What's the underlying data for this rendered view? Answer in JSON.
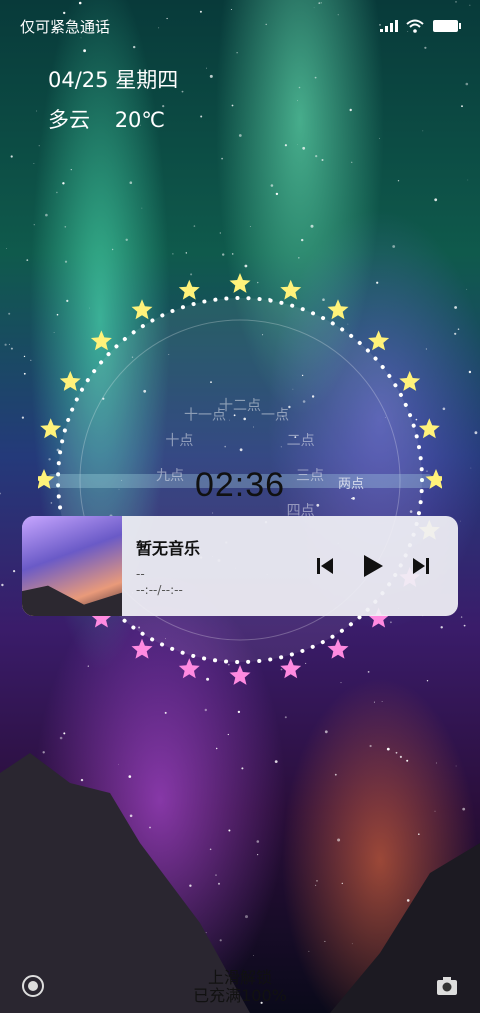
{
  "status_bar": {
    "left_text": "仅可紧急通话",
    "icons": [
      "signal-icon",
      "wifi-icon",
      "battery-icon"
    ]
  },
  "lockscreen": {
    "date": "04/25 星期四",
    "weather_condition": "多云",
    "temperature": "20℃",
    "time": "02:36"
  },
  "clock_face": {
    "hour_label": "两点",
    "hour_chars": [
      "一点",
      "二点",
      "三点",
      "四点",
      "九点",
      "十点",
      "十一点",
      "十二点"
    ]
  },
  "music": {
    "title": "暂无音乐",
    "artist": "--",
    "progress": "--:--/--:--",
    "controls": [
      "previous-icon",
      "play-icon",
      "next-icon"
    ]
  },
  "bottom": {
    "swipe_hint": "上滑解锁",
    "charge_status": "已充满100%"
  },
  "colors": {
    "star_yellow": "#fff27a",
    "star_pink": "#ff8ae0",
    "ring": "#ffffff"
  }
}
